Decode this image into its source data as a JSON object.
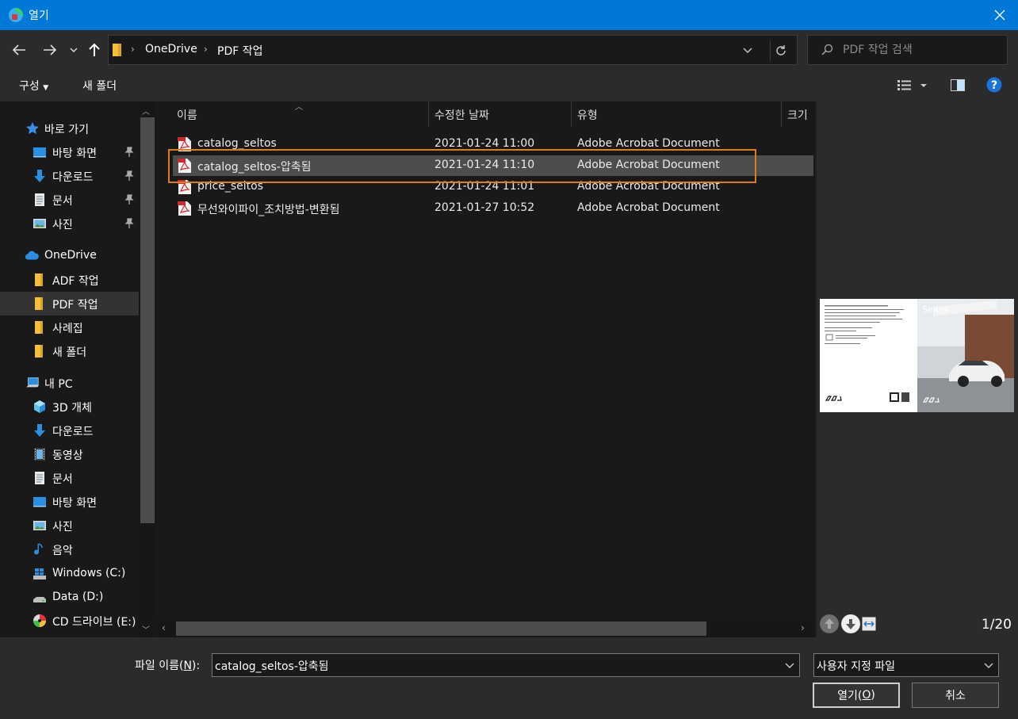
{
  "window": {
    "title": "열기",
    "close_glyph": "✕"
  },
  "nav": {
    "breadcrumb": [
      "OneDrive",
      "PDF 작업"
    ],
    "search_placeholder": "PDF 작업 검색"
  },
  "toolbar": {
    "organize": "구성",
    "new_folder": "새 폴더"
  },
  "sidebar": {
    "items": [
      {
        "label": "바로 가기",
        "icon": "star-icon",
        "pinned": false
      },
      {
        "label": "바탕 화면",
        "icon": "desktop-icon",
        "pinned": true
      },
      {
        "label": "다운로드",
        "icon": "download-icon",
        "pinned": true
      },
      {
        "label": "문서",
        "icon": "document-icon",
        "pinned": true
      },
      {
        "label": "사진",
        "icon": "pictures-icon",
        "pinned": true
      },
      {
        "label": "OneDrive",
        "icon": "cloud-icon",
        "pinned": false
      },
      {
        "label": "ADF 작업",
        "icon": "folder-icon",
        "pinned": false
      },
      {
        "label": "PDF 작업",
        "icon": "folder-icon",
        "pinned": false,
        "selected": true
      },
      {
        "label": "사례집",
        "icon": "folder-icon",
        "pinned": false
      },
      {
        "label": "새 폴더",
        "icon": "folder-icon",
        "pinned": false
      },
      {
        "label": "내 PC",
        "icon": "pc-icon",
        "pinned": false
      },
      {
        "label": "3D 개체",
        "icon": "cube-icon",
        "pinned": false
      },
      {
        "label": "다운로드",
        "icon": "download-icon",
        "pinned": false
      },
      {
        "label": "동영상",
        "icon": "video-icon",
        "pinned": false
      },
      {
        "label": "문서",
        "icon": "document-icon",
        "pinned": false
      },
      {
        "label": "바탕 화면",
        "icon": "desktop-icon",
        "pinned": false
      },
      {
        "label": "사진",
        "icon": "pictures-icon",
        "pinned": false
      },
      {
        "label": "음악",
        "icon": "music-icon",
        "pinned": false
      },
      {
        "label": "Windows (C:)",
        "icon": "windows-drive-icon",
        "pinned": false
      },
      {
        "label": "Data (D:)",
        "icon": "drive-icon",
        "pinned": false
      },
      {
        "label": "CD 드라이브 (E:)",
        "icon": "cd-drive-icon",
        "pinned": false
      }
    ]
  },
  "filelist": {
    "columns": {
      "name": "이름",
      "date": "수정한 날짜",
      "type": "유형",
      "size": "크기"
    },
    "rows": [
      {
        "name": "catalog_seltos",
        "date": "2021-01-24 11:00",
        "type": "Adobe Acrobat Document"
      },
      {
        "name": "catalog_seltos-압축됨",
        "date": "2021-01-24 11:10",
        "type": "Adobe Acrobat Document",
        "selected": true
      },
      {
        "name": "price_seltos",
        "date": "2021-01-24 11:01",
        "type": "Adobe Acrobat Document"
      },
      {
        "name": "무선와이파이_조치방법-변환됨",
        "date": "2021-01-27 10:52",
        "type": "Adobe Acrobat Document"
      }
    ]
  },
  "preview": {
    "page_title": "Seltos",
    "page_count": "1/20"
  },
  "bottom": {
    "filename_label_pre": "파일 이름(",
    "filename_label_key": "N",
    "filename_label_post": "):",
    "filename_value": "catalog_seltos-압축됨",
    "filetype_value": "사용자 지정 파일",
    "open_pre": "열기(",
    "open_key": "O",
    "open_post": ")",
    "cancel": "취소"
  },
  "colors": {
    "accent": "#0078d7",
    "focus": "#e07b1e"
  }
}
